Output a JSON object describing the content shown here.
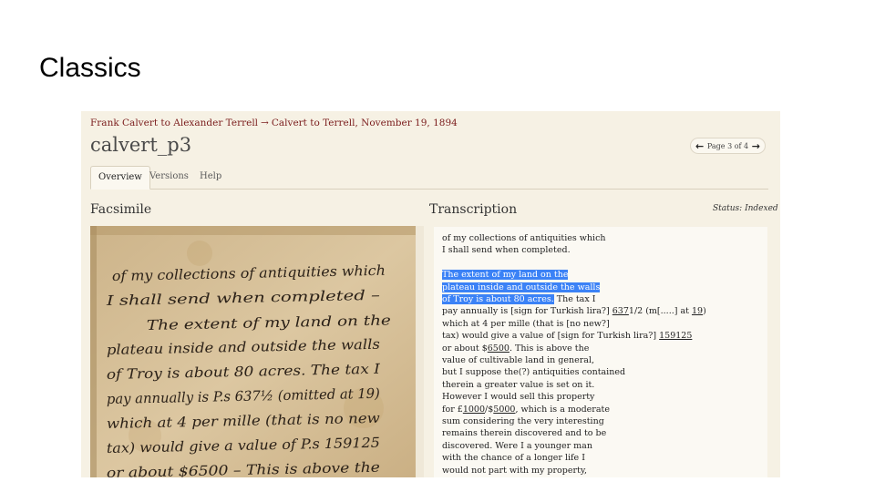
{
  "slide": {
    "title": "Classics"
  },
  "header": {
    "breadcrumb": [
      "Frank Calvert to Alexander Terrell",
      "→",
      "Calvert to Terrell, November 19, 1894"
    ],
    "page_title": "calvert_p3",
    "pager": {
      "prev": "←",
      "label": "Page 3 of 4",
      "next": "→"
    }
  },
  "tabs": [
    "Overview",
    "Versions",
    "Help"
  ],
  "facsimile": {
    "heading": "Facsimile",
    "handwriting_lines": [
      "of my collections of antiquities which",
      "I shall send when completed –",
      "The extent of my land on the",
      "plateau inside and outside the walls",
      "of Troy is about 80 acres. The tax I",
      "pay annually is P.s 637½ (omitted at 19)",
      "which at 4 per mille (that is no new",
      "tax) would give a value of P.s 159125",
      "or about $6500 – This is above the"
    ]
  },
  "transcription": {
    "heading": "Transcription",
    "status": "Status: Indexed",
    "lines": [
      [
        {
          "t": "of my collections of antiquities which"
        }
      ],
      [
        {
          "t": "I shall send when completed."
        }
      ],
      [
        {
          "t": ""
        }
      ],
      [
        {
          "t": "The extent of my land on the",
          "hl": true
        }
      ],
      [
        {
          "t": "plateau inside and outside the walls",
          "hl": true
        }
      ],
      [
        {
          "t": "of Troy is about 80 acres.",
          "hl": true
        },
        {
          "t": " The tax I"
        }
      ],
      [
        {
          "t": "pay annually is [sign for Turkish lira?] "
        },
        {
          "t": "637",
          "u": true
        },
        {
          "t": "1/2 (m[.....] at "
        },
        {
          "t": "19",
          "u": true
        },
        {
          "t": ")"
        }
      ],
      [
        {
          "t": "which at 4 per mille (that is [no new?]"
        }
      ],
      [
        {
          "t": "tax) would give a value of [sign for Turkish lira?] "
        },
        {
          "t": "159125",
          "u": true
        }
      ],
      [
        {
          "t": "or about $"
        },
        {
          "t": "6500",
          "u": true
        },
        {
          "t": ". This is above the"
        }
      ],
      [
        {
          "t": "value of cultivable land in general,"
        }
      ],
      [
        {
          "t": "but I suppose the(?) antiquities contained"
        }
      ],
      [
        {
          "t": "therein a greater value is set on it."
        }
      ],
      [
        {
          "t": "However I would sell this property"
        }
      ],
      [
        {
          "t": "for £"
        },
        {
          "t": "1000",
          "u": true
        },
        {
          "t": "/$"
        },
        {
          "t": "5000",
          "u": true
        },
        {
          "t": ", which is a moderate"
        }
      ],
      [
        {
          "t": "sum considering the very interesting"
        }
      ],
      [
        {
          "t": "remains therein discovered and to be"
        }
      ],
      [
        {
          "t": "discovered. Were I a younger man"
        }
      ],
      [
        {
          "t": "with the chance of a longer life I"
        }
      ],
      [
        {
          "t": "would not part with my property,"
        }
      ]
    ]
  },
  "colors": {
    "accent": "#7b1d1d",
    "highlight": "#3b82f6",
    "panel_bg": "#f6f1e4",
    "paper": "#d8c29b",
    "ink": "#2b2118"
  }
}
